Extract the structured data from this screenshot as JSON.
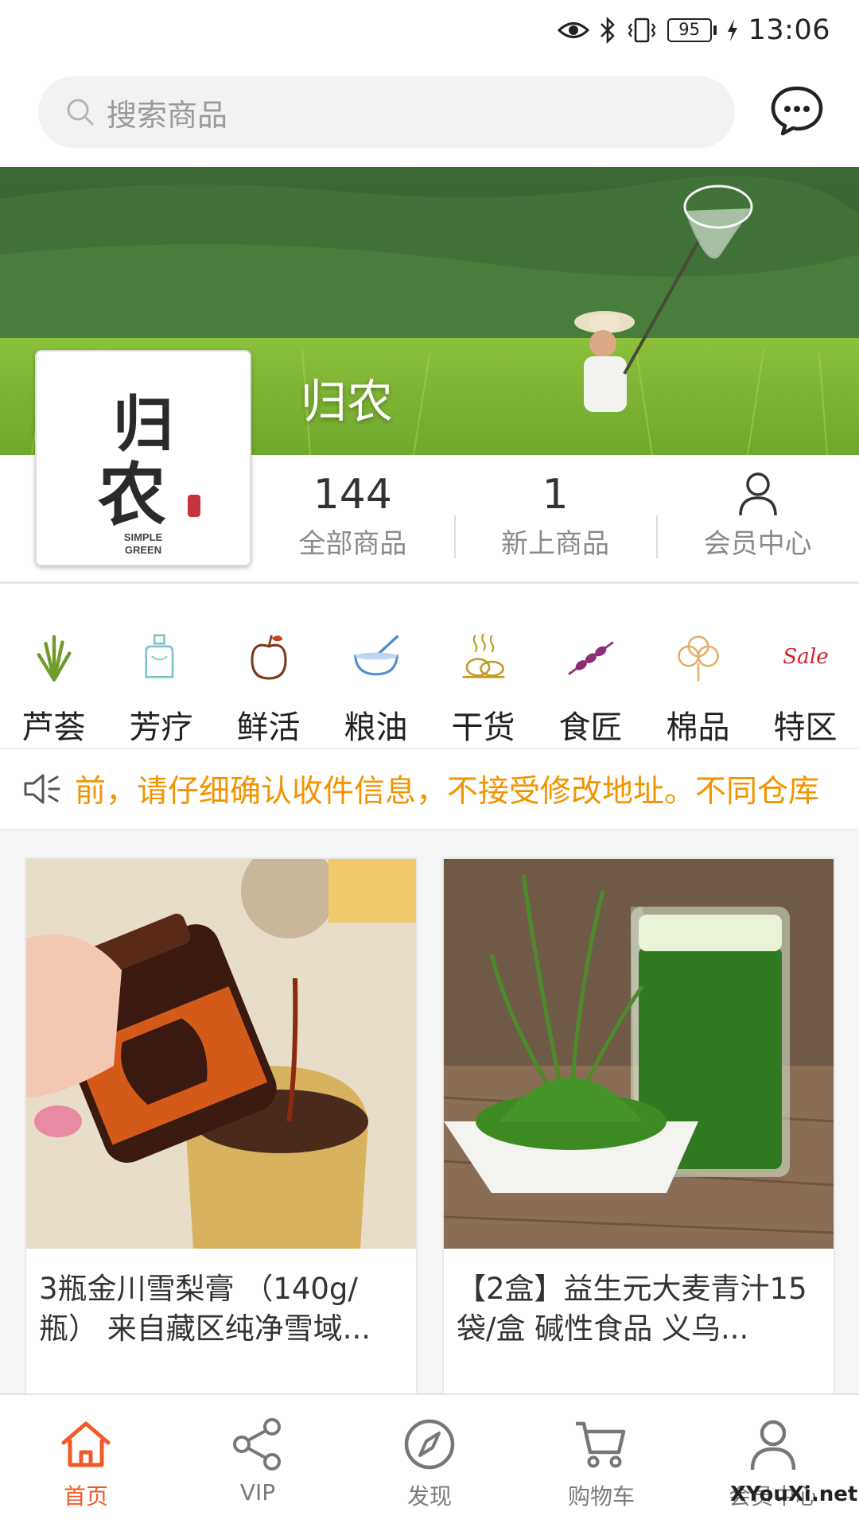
{
  "status_bar": {
    "battery": "95",
    "time": "13:06"
  },
  "search": {
    "placeholder": "搜索商品"
  },
  "shop": {
    "name": "归农",
    "logo_text": "归农",
    "logo_sub_line1": "SIMPLE",
    "logo_sub_line2": "GREEN",
    "stats": [
      {
        "value": "144",
        "label": "全部商品"
      },
      {
        "value": "1",
        "label": "新上商品"
      },
      {
        "label": "会员中心"
      }
    ]
  },
  "categories": [
    {
      "label": "芦荟",
      "icon": "aloe-icon"
    },
    {
      "label": "芳疗",
      "icon": "aroma-bottle-icon"
    },
    {
      "label": "鲜活",
      "icon": "fruit-icon"
    },
    {
      "label": "粮油",
      "icon": "grain-bowl-icon"
    },
    {
      "label": "干货",
      "icon": "dried-goods-icon"
    },
    {
      "label": "食匠",
      "icon": "skewer-icon"
    },
    {
      "label": "棉品",
      "icon": "cotton-icon"
    },
    {
      "label": "特区",
      "icon": "sale-icon",
      "icon_text": "Sale"
    }
  ],
  "notice": {
    "text": "前，请仔细确认收件信息，不接受修改地址。不同仓库"
  },
  "products": [
    {
      "title": "3瓶金川雪梨膏 （140g/瓶） 来自藏区纯净雪域..."
    },
    {
      "title": "【2盒】益生元大麦青汁15袋/盒 碱性食品 义乌..."
    }
  ],
  "bottom_nav": [
    {
      "label": "首页",
      "icon": "home-icon",
      "active": true
    },
    {
      "label": "VIP",
      "icon": "share-icon",
      "active": false
    },
    {
      "label": "发现",
      "icon": "compass-icon",
      "active": false
    },
    {
      "label": "购物车",
      "icon": "cart-icon",
      "active": false
    },
    {
      "label": "会员中心",
      "icon": "user-icon",
      "active": false
    }
  ],
  "colors": {
    "accent": "#f05a28",
    "notice_text": "#f29400",
    "gray_text": "#8a8a8a"
  },
  "watermark": "XYouXi.net"
}
